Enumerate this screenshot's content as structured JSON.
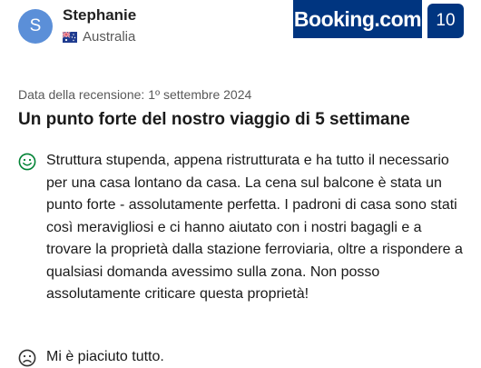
{
  "reviewer": {
    "initial": "S",
    "name": "Stephanie",
    "country": "Australia",
    "flag_icon": "australia-flag-icon"
  },
  "brand": {
    "name": "Booking.com",
    "color": "#003580"
  },
  "score": "10",
  "review": {
    "date_label": "Data della recensione: 1º settembre 2024",
    "title": "Un punto forte del nostro viaggio di 5 settimane",
    "positive": "Struttura stupenda, appena ristrutturata e ha tutto il necessario per una casa lontano da casa. La cena sul balcone è stata un punto forte - assolutamente perfetta. I padroni di casa sono stati così meravigliosi e ci hanno aiutato con i nostri bagagli e a trovare la proprietà dalla stazione ferroviaria, oltre a rispondere a qualsiasi domanda avessimo sulla zona. Non posso assolutamente criticare questa proprietà!",
    "positive_icon": "smile-icon",
    "negative": "Mi è piaciuto tutto.",
    "negative_icon": "frown-icon"
  },
  "colors": {
    "avatar": "#5b8fd8",
    "positive_icon": "#008234",
    "negative_icon": "#333333"
  }
}
